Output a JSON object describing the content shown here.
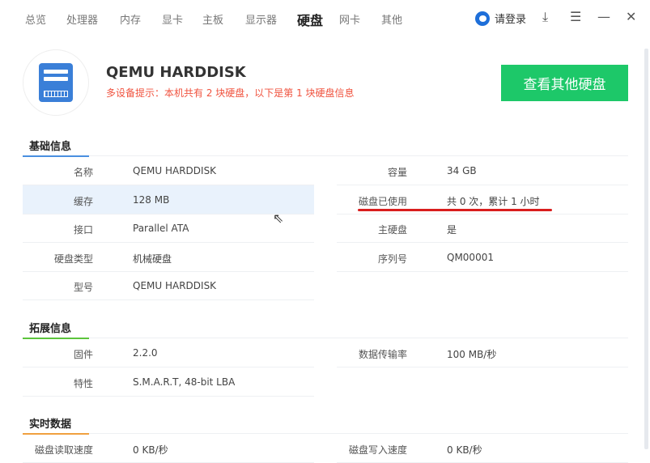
{
  "nav": {
    "tabs": [
      "总览",
      "处理器",
      "内存",
      "显卡",
      "主板",
      "显示器",
      "硬盘",
      "网卡",
      "其他"
    ],
    "active": "硬盘",
    "login": "请登录",
    "download": "⤓",
    "menu": "☰",
    "minimize": "—",
    "close": "✕"
  },
  "disk": {
    "title": "QEMU HARDDISK",
    "hint": "多设备提示：本机共有 2 块硬盘，以下是第 1 块硬盘信息",
    "button": "查看其他硬盘"
  },
  "sections": [
    {
      "title": "基础信息",
      "color": "#4a8fe0",
      "left": [
        [
          "名称",
          "QEMU HARDDISK"
        ],
        [
          "缓存",
          "128 MB"
        ],
        [
          "接口",
          "Parallel ATA"
        ],
        [
          "硬盘类型",
          "机械硬盘"
        ],
        [
          "型号",
          "QEMU HARDDISK"
        ]
      ],
      "right": [
        [
          "容量",
          "34 GB"
        ],
        [
          "磁盘已使用",
          "共 0 次，累计 1 小时"
        ],
        [
          "主硬盘",
          "是"
        ],
        [
          "序列号",
          "QM00001"
        ]
      ]
    },
    {
      "title": "拓展信息",
      "color": "#5cc43c",
      "left": [
        [
          "固件",
          "2.2.0"
        ],
        [
          "特性",
          "S.M.A.R.T, 48-bit LBA"
        ]
      ],
      "right": [
        [
          "数据传输率",
          "100 MB/秒"
        ]
      ]
    },
    {
      "title": "实时数据",
      "color": "#f0a040",
      "left": [
        [
          "磁盘读取速度",
          "0 KB/秒"
        ]
      ],
      "right": [
        [
          "磁盘写入速度",
          "0 KB/秒"
        ]
      ]
    }
  ]
}
